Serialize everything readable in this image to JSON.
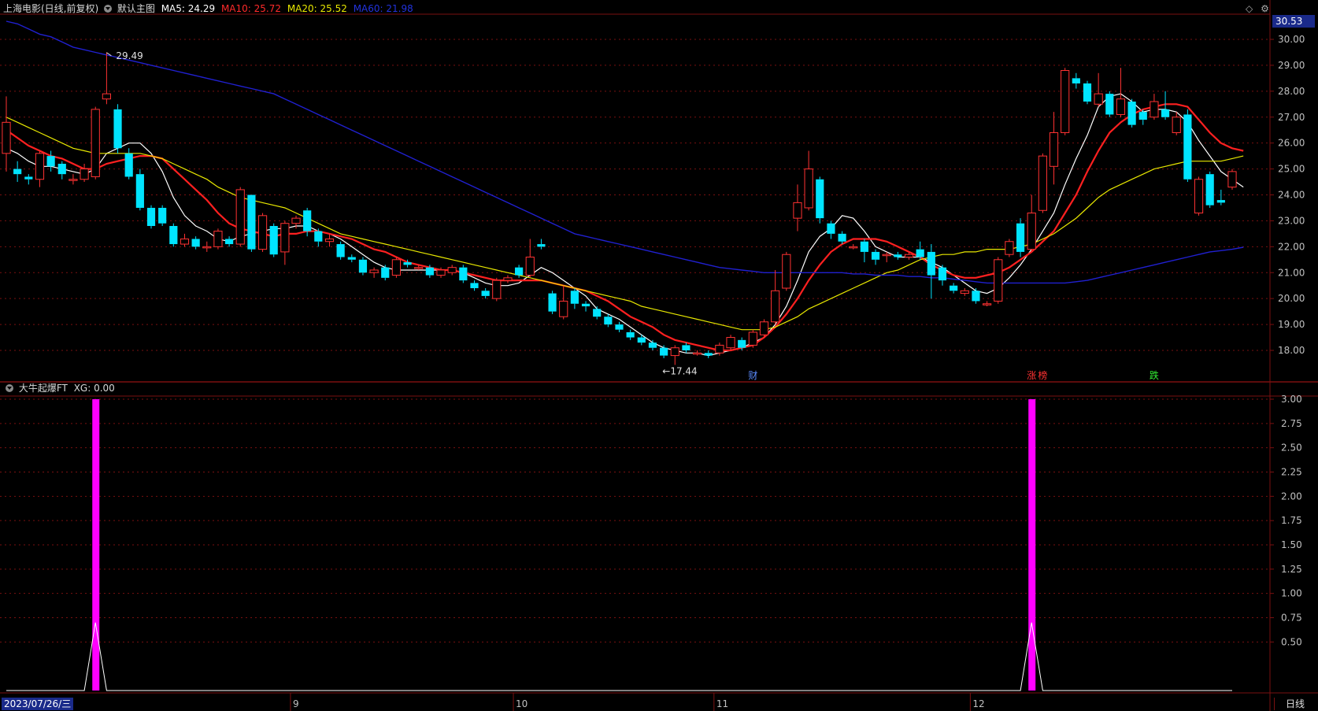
{
  "header": {
    "stock_name": "上海电影(日线,前复权)",
    "main_chart_label": "默认主图",
    "ma5": "MA5: 24.29",
    "ma10": "MA10: 25.72",
    "ma20": "MA20: 25.52",
    "ma60": "MA60: 21.98",
    "current_price_badge": "30.53"
  },
  "indicator": {
    "name": "大牛起爆FT",
    "value": "XG: 0.00"
  },
  "x_axis": {
    "start_date": "2023/07/26/三",
    "months": [
      "9",
      "10",
      "11",
      "12"
    ],
    "period_button": "日线"
  },
  "annotations": {
    "high": "29.49",
    "low": "17.44",
    "marks": [
      "财",
      "涨",
      "榜",
      "跌"
    ]
  },
  "colors": {
    "up": "#ff3232",
    "down": "#00e4ff",
    "ma5": "#ffffff",
    "ma10": "#ff2020",
    "ma20": "#e8e800",
    "ma60": "#2020d0",
    "signal": "#ff00ff",
    "grid": "#7a1010"
  },
  "chart_data": [
    {
      "type": "candlestick",
      "title": "上海电影(日线,前复权)",
      "y_axis_ticks": [
        18.0,
        19.0,
        20.0,
        21.0,
        22.0,
        23.0,
        24.0,
        25.0,
        26.0,
        27.0,
        28.0,
        29.0,
        30.0
      ],
      "ylim": [
        17.2,
        30.8
      ],
      "candles": [
        [
          25.6,
          26.8,
          24.9,
          27.8
        ],
        [
          25.0,
          24.8,
          24.5,
          25.3
        ],
        [
          24.7,
          24.6,
          24.4,
          24.8
        ],
        [
          24.6,
          25.6,
          24.3,
          25.7
        ],
        [
          25.5,
          25.1,
          24.9,
          25.7
        ],
        [
          25.2,
          24.8,
          24.6,
          25.3
        ],
        [
          24.6,
          24.6,
          24.4,
          24.8
        ],
        [
          24.6,
          25.0,
          24.5,
          25.2
        ],
        [
          24.7,
          27.3,
          24.6,
          27.4
        ],
        [
          27.7,
          27.9,
          27.5,
          29.5
        ],
        [
          27.3,
          25.8,
          25.6,
          27.5
        ],
        [
          25.6,
          24.7,
          24.6,
          25.8
        ],
        [
          24.8,
          23.5,
          23.4,
          25.0
        ],
        [
          23.5,
          22.8,
          22.7,
          23.6
        ],
        [
          23.5,
          22.9,
          22.8,
          23.6
        ],
        [
          22.8,
          22.1,
          22.0,
          22.9
        ],
        [
          22.1,
          22.3,
          22.0,
          22.5
        ],
        [
          22.3,
          22.0,
          21.9,
          22.4
        ],
        [
          22.0,
          22.0,
          21.8,
          22.2
        ],
        [
          22.0,
          22.6,
          21.9,
          22.7
        ],
        [
          22.3,
          22.1,
          22.0,
          22.4
        ],
        [
          22.1,
          24.2,
          22.0,
          24.3
        ],
        [
          24.0,
          21.9,
          21.8,
          24.0
        ],
        [
          21.9,
          23.2,
          21.8,
          23.3
        ],
        [
          22.8,
          21.7,
          21.6,
          22.9
        ],
        [
          21.8,
          22.9,
          21.3,
          23.0
        ],
        [
          22.9,
          23.1,
          22.7,
          23.2
        ],
        [
          23.4,
          22.6,
          22.4,
          23.5
        ],
        [
          22.6,
          22.2,
          22.0,
          22.7
        ],
        [
          22.2,
          22.3,
          22.0,
          22.5
        ],
        [
          22.1,
          21.6,
          21.5,
          22.2
        ],
        [
          21.6,
          21.5,
          21.4,
          21.7
        ],
        [
          21.5,
          21.0,
          20.9,
          21.6
        ],
        [
          21.0,
          21.1,
          20.8,
          21.2
        ],
        [
          21.2,
          20.8,
          20.7,
          21.3
        ],
        [
          20.9,
          21.5,
          20.8,
          21.6
        ],
        [
          21.4,
          21.3,
          21.2,
          21.5
        ],
        [
          21.2,
          21.2,
          21.1,
          21.3
        ],
        [
          21.2,
          20.9,
          20.8,
          21.3
        ],
        [
          20.9,
          21.1,
          20.8,
          21.2
        ],
        [
          21.0,
          21.2,
          20.9,
          21.3
        ],
        [
          21.2,
          20.7,
          20.6,
          21.3
        ],
        [
          20.6,
          20.4,
          20.3,
          20.7
        ],
        [
          20.3,
          20.1,
          20.0,
          20.4
        ],
        [
          20.0,
          20.7,
          19.9,
          20.8
        ],
        [
          20.7,
          20.8,
          20.6,
          20.9
        ],
        [
          21.2,
          20.9,
          20.8,
          21.3
        ],
        [
          20.9,
          21.6,
          20.8,
          22.3
        ],
        [
          22.1,
          22.0,
          21.9,
          22.3
        ],
        [
          20.2,
          19.5,
          19.4,
          20.3
        ],
        [
          19.3,
          19.9,
          19.2,
          20.5
        ],
        [
          20.3,
          19.8,
          19.6,
          20.4
        ],
        [
          19.8,
          19.7,
          19.5,
          19.9
        ],
        [
          19.6,
          19.3,
          19.2,
          19.7
        ],
        [
          19.3,
          19.0,
          18.9,
          19.4
        ],
        [
          19.0,
          18.8,
          18.7,
          19.1
        ],
        [
          18.7,
          18.5,
          18.4,
          18.8
        ],
        [
          18.5,
          18.3,
          18.2,
          18.6
        ],
        [
          18.3,
          18.1,
          18.0,
          18.4
        ],
        [
          18.1,
          17.8,
          17.7,
          18.2
        ],
        [
          17.8,
          18.1,
          17.44,
          18.2
        ],
        [
          18.2,
          18.0,
          17.9,
          18.3
        ],
        [
          17.9,
          17.9,
          17.8,
          18.0
        ],
        [
          17.9,
          17.8,
          17.7,
          18.0
        ],
        [
          17.9,
          18.2,
          17.8,
          18.3
        ],
        [
          18.1,
          18.5,
          18.0,
          18.6
        ],
        [
          18.4,
          18.1,
          18.0,
          18.5
        ],
        [
          18.2,
          18.7,
          18.1,
          18.8
        ],
        [
          18.6,
          19.1,
          18.5,
          19.2
        ],
        [
          19.1,
          20.3,
          19.0,
          21.1
        ],
        [
          20.4,
          21.7,
          20.3,
          21.8
        ],
        [
          23.1,
          23.7,
          22.6,
          24.4
        ],
        [
          23.5,
          25.0,
          23.4,
          25.7
        ],
        [
          24.6,
          23.1,
          22.9,
          24.7
        ],
        [
          22.9,
          22.5,
          22.3,
          23.0
        ],
        [
          22.5,
          22.2,
          22.1,
          22.6
        ],
        [
          22.0,
          22.0,
          21.9,
          22.1
        ],
        [
          22.2,
          21.8,
          21.4,
          22.3
        ],
        [
          21.8,
          21.5,
          21.3,
          21.9
        ],
        [
          21.7,
          21.7,
          21.4,
          21.8
        ],
        [
          21.7,
          21.6,
          21.5,
          21.8
        ],
        [
          21.6,
          21.7,
          21.5,
          21.8
        ],
        [
          21.9,
          21.6,
          21.5,
          22.2
        ],
        [
          21.8,
          20.9,
          20.0,
          22.1
        ],
        [
          21.2,
          20.7,
          20.5,
          21.3
        ],
        [
          20.5,
          20.3,
          20.2,
          20.6
        ],
        [
          20.2,
          20.3,
          20.1,
          20.4
        ],
        [
          20.3,
          19.9,
          19.8,
          20.4
        ],
        [
          19.8,
          19.8,
          19.7,
          19.9
        ],
        [
          19.9,
          21.5,
          19.8,
          21.6
        ],
        [
          21.7,
          22.2,
          21.6,
          22.3
        ],
        [
          22.9,
          21.8,
          21.6,
          23.1
        ],
        [
          21.9,
          23.3,
          21.8,
          24.0
        ],
        [
          23.4,
          25.5,
          23.3,
          25.6
        ],
        [
          25.1,
          26.4,
          24.4,
          27.2
        ],
        [
          26.4,
          28.8,
          26.3,
          28.9
        ],
        [
          28.5,
          28.3,
          28.1,
          28.7
        ],
        [
          28.3,
          27.6,
          27.5,
          28.4
        ],
        [
          27.5,
          27.9,
          27.4,
          28.7
        ],
        [
          27.9,
          27.1,
          27.0,
          28.0
        ],
        [
          27.1,
          27.7,
          27.0,
          28.9
        ],
        [
          27.6,
          26.7,
          26.6,
          27.7
        ],
        [
          27.2,
          26.9,
          26.7,
          27.3
        ],
        [
          27.0,
          27.6,
          26.9,
          27.9
        ],
        [
          27.3,
          27.0,
          26.9,
          28.0
        ],
        [
          26.4,
          27.0,
          26.3,
          27.2
        ],
        [
          27.1,
          24.6,
          24.5,
          27.3
        ],
        [
          23.3,
          24.6,
          23.2,
          24.7
        ],
        [
          24.8,
          23.6,
          23.5,
          24.9
        ],
        [
          23.8,
          23.7,
          23.6,
          24.2
        ],
        [
          24.3,
          24.9,
          24.2,
          25.0
        ]
      ],
      "series": [
        {
          "name": "MA5",
          "values": [
            25.8,
            25.6,
            25.3,
            25.1,
            25.1,
            25.0,
            24.9,
            24.8,
            25.0,
            25.6,
            25.8,
            26.0,
            26.0,
            25.6,
            24.9,
            23.9,
            23.2,
            22.8,
            22.6,
            22.3,
            22.2,
            22.4,
            22.5,
            22.6,
            22.7,
            22.7,
            22.8,
            22.8,
            22.6,
            22.5,
            22.3,
            22.0,
            21.7,
            21.4,
            21.2,
            21.1,
            21.1,
            21.1,
            21.1,
            21.1,
            21.1,
            21.0,
            20.8,
            20.6,
            20.5,
            20.5,
            20.6,
            20.9,
            21.2,
            21.0,
            20.7,
            20.4,
            20.1,
            19.6,
            19.4,
            19.2,
            18.9,
            18.6,
            18.3,
            18.1,
            18.0,
            17.9,
            17.9,
            17.8,
            17.9,
            18.0,
            18.1,
            18.3,
            18.5,
            19.0,
            19.7,
            20.7,
            21.8,
            22.4,
            22.7,
            23.2,
            23.1,
            22.6,
            22.0,
            21.8,
            21.6,
            21.6,
            21.6,
            21.4,
            21.2,
            20.9,
            20.6,
            20.3,
            20.2,
            20.4,
            20.8,
            21.3,
            21.9,
            22.6,
            23.3,
            24.4,
            25.4,
            26.3,
            27.4,
            27.8,
            27.9,
            27.6,
            27.2,
            27.3,
            27.3,
            27.2,
            26.8,
            26.1,
            25.5,
            24.9,
            24.6,
            24.3
          ]
        },
        {
          "name": "MA10",
          "values": [
            26.5,
            26.2,
            25.9,
            25.7,
            25.5,
            25.4,
            25.2,
            25.0,
            25.0,
            25.2,
            25.3,
            25.4,
            25.5,
            25.5,
            25.4,
            25.0,
            24.6,
            24.2,
            23.8,
            23.3,
            22.9,
            22.7,
            22.6,
            22.5,
            22.4,
            22.5,
            22.5,
            22.6,
            22.6,
            22.5,
            22.4,
            22.3,
            22.1,
            21.9,
            21.8,
            21.6,
            21.4,
            21.3,
            21.2,
            21.1,
            21.1,
            21.0,
            20.9,
            20.8,
            20.7,
            20.7,
            20.7,
            20.7,
            20.7,
            20.6,
            20.5,
            20.4,
            20.3,
            20.1,
            19.9,
            19.6,
            19.3,
            19.1,
            18.9,
            18.6,
            18.4,
            18.3,
            18.2,
            18.1,
            18.0,
            18.0,
            18.1,
            18.2,
            18.5,
            18.9,
            19.4,
            20.0,
            20.7,
            21.3,
            21.8,
            22.1,
            22.3,
            22.3,
            22.3,
            22.2,
            22.0,
            21.8,
            21.6,
            21.3,
            21.1,
            20.9,
            20.8,
            20.8,
            20.9,
            21.0,
            21.2,
            21.5,
            21.8,
            22.2,
            22.6,
            23.3,
            24.0,
            24.9,
            25.7,
            26.4,
            26.8,
            27.1,
            27.3,
            27.4,
            27.5,
            27.5,
            27.4,
            26.9,
            26.4,
            26.0,
            25.8,
            25.7
          ]
        },
        {
          "name": "MA20",
          "values": [
            27.0,
            26.8,
            26.6,
            26.4,
            26.2,
            26.0,
            25.8,
            25.7,
            25.6,
            25.6,
            25.6,
            25.6,
            25.6,
            25.5,
            25.4,
            25.2,
            25.0,
            24.8,
            24.6,
            24.3,
            24.1,
            23.9,
            23.8,
            23.7,
            23.6,
            23.5,
            23.3,
            23.1,
            22.9,
            22.7,
            22.5,
            22.4,
            22.3,
            22.2,
            22.1,
            22.0,
            21.9,
            21.8,
            21.7,
            21.6,
            21.5,
            21.4,
            21.3,
            21.2,
            21.1,
            21.0,
            20.9,
            20.8,
            20.7,
            20.6,
            20.5,
            20.4,
            20.3,
            20.2,
            20.1,
            20.0,
            19.9,
            19.7,
            19.6,
            19.5,
            19.4,
            19.3,
            19.2,
            19.1,
            19.0,
            18.9,
            18.8,
            18.8,
            18.8,
            18.9,
            19.1,
            19.3,
            19.6,
            19.8,
            20.0,
            20.2,
            20.4,
            20.6,
            20.8,
            21.0,
            21.1,
            21.3,
            21.5,
            21.6,
            21.7,
            21.7,
            21.8,
            21.8,
            21.9,
            21.9,
            21.9,
            22.0,
            22.1,
            22.3,
            22.5,
            22.8,
            23.1,
            23.5,
            23.9,
            24.2,
            24.4,
            24.6,
            24.8,
            25.0,
            25.1,
            25.2,
            25.3,
            25.3,
            25.3,
            25.3,
            25.4,
            25.5
          ]
        },
        {
          "name": "MA60",
          "values": [
            30.7,
            30.6,
            30.4,
            30.2,
            30.1,
            29.9,
            29.7,
            29.6,
            29.5,
            29.4,
            29.3,
            29.2,
            29.1,
            29.0,
            28.9,
            28.8,
            28.7,
            28.6,
            28.5,
            28.4,
            28.3,
            28.2,
            28.1,
            28.0,
            27.9,
            27.7,
            27.5,
            27.3,
            27.1,
            26.9,
            26.7,
            26.5,
            26.3,
            26.1,
            25.9,
            25.7,
            25.5,
            25.3,
            25.1,
            24.9,
            24.7,
            24.5,
            24.3,
            24.1,
            23.9,
            23.7,
            23.5,
            23.3,
            23.1,
            22.9,
            22.7,
            22.5,
            22.4,
            22.3,
            22.2,
            22.1,
            22.0,
            21.9,
            21.8,
            21.7,
            21.6,
            21.5,
            21.4,
            21.3,
            21.2,
            21.15,
            21.1,
            21.05,
            21.0,
            21.0,
            21.0,
            21.0,
            21.0,
            21.0,
            21.0,
            21.0,
            20.95,
            20.95,
            20.9,
            20.9,
            20.9,
            20.85,
            20.85,
            20.8,
            20.8,
            20.75,
            20.7,
            20.65,
            20.6,
            20.6,
            20.6,
            20.6,
            20.6,
            20.6,
            20.6,
            20.6,
            20.65,
            20.7,
            20.8,
            20.9,
            21.0,
            21.1,
            21.2,
            21.3,
            21.4,
            21.5,
            21.6,
            21.7,
            21.8,
            21.85,
            21.9,
            21.98
          ]
        }
      ]
    },
    {
      "type": "bar",
      "title": "大牛起爆FT",
      "y_axis_ticks": [
        0.5,
        0.75,
        1.0,
        1.25,
        1.5,
        1.75,
        2.0,
        2.25,
        2.5,
        2.75,
        3.0
      ],
      "ylim": [
        0,
        3.2
      ],
      "series": [
        {
          "name": "XG",
          "signal_indices": [
            8,
            92
          ],
          "signal_value": 3.0
        },
        {
          "name": "line",
          "peak_indices": [
            8,
            92
          ],
          "peak_value": 0.7
        }
      ]
    }
  ]
}
